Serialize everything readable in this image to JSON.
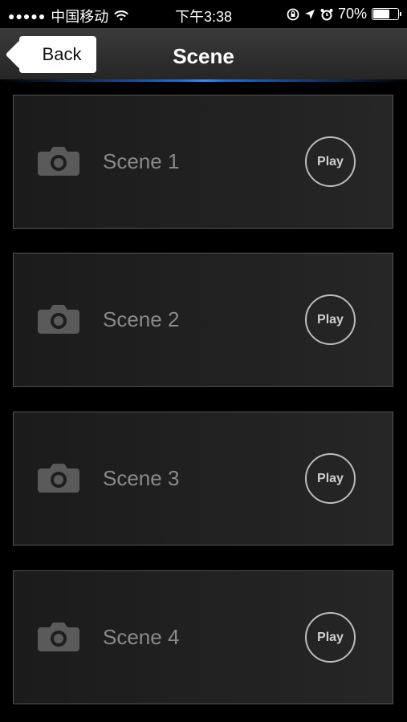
{
  "status_bar": {
    "signal": "●●●●●",
    "carrier": "中国移动",
    "time": "下午3:38",
    "battery": "70%",
    "battery_level": 0.7
  },
  "nav": {
    "back_label": "Back",
    "title": "Scene"
  },
  "scenes": [
    {
      "label": "Scene 1",
      "play_label": "Play"
    },
    {
      "label": "Scene 2",
      "play_label": "Play"
    },
    {
      "label": "Scene 3",
      "play_label": "Play"
    },
    {
      "label": "Scene 4",
      "play_label": "Play"
    }
  ],
  "icons": {
    "wifi": "wifi-icon",
    "rotation_lock": "rotation-lock-icon",
    "location": "location-arrow-icon",
    "alarm": "alarm-clock-icon",
    "battery": "battery-icon",
    "camera": "camera-icon"
  },
  "colors": {
    "accent": "#1b6ed6",
    "card_bg": "#1f1f1f",
    "label": "#8a8a8a"
  }
}
